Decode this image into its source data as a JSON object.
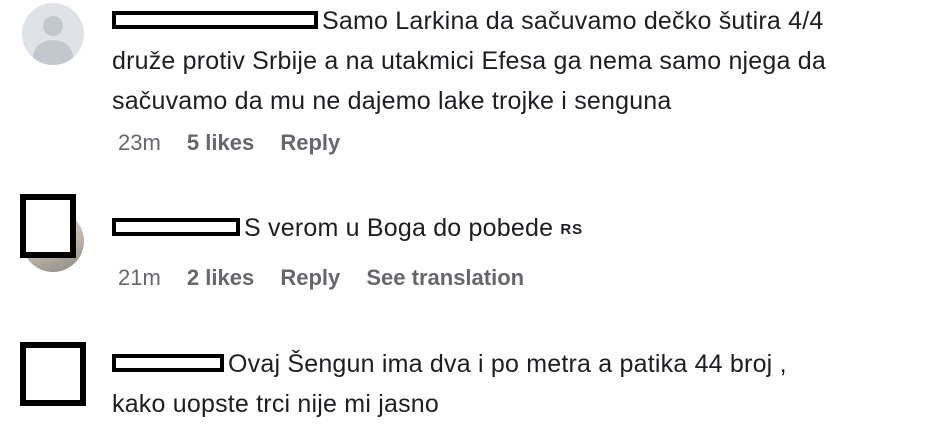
{
  "comments": [
    {
      "lines": [
        "Samo Larkina da sačuvamo dečko šutira 4/4",
        "druže protiv Srbije a na utakmici Efesa ga nema samo njega da",
        "sačuvamo da mu ne dajemo lake trojke i senguna"
      ],
      "time": "23m",
      "likes": "5 likes",
      "reply": "Reply"
    },
    {
      "lines": [
        "S verom u Boga do pobede"
      ],
      "flag": "RS",
      "time": "21m",
      "likes": "2 likes",
      "reply": "Reply",
      "translate": "See translation"
    },
    {
      "lines": [
        "Ovaj Šengun ima dva i po metra a patika 44 broj ,",
        "kako uopste trci nije mi jasno"
      ]
    }
  ]
}
